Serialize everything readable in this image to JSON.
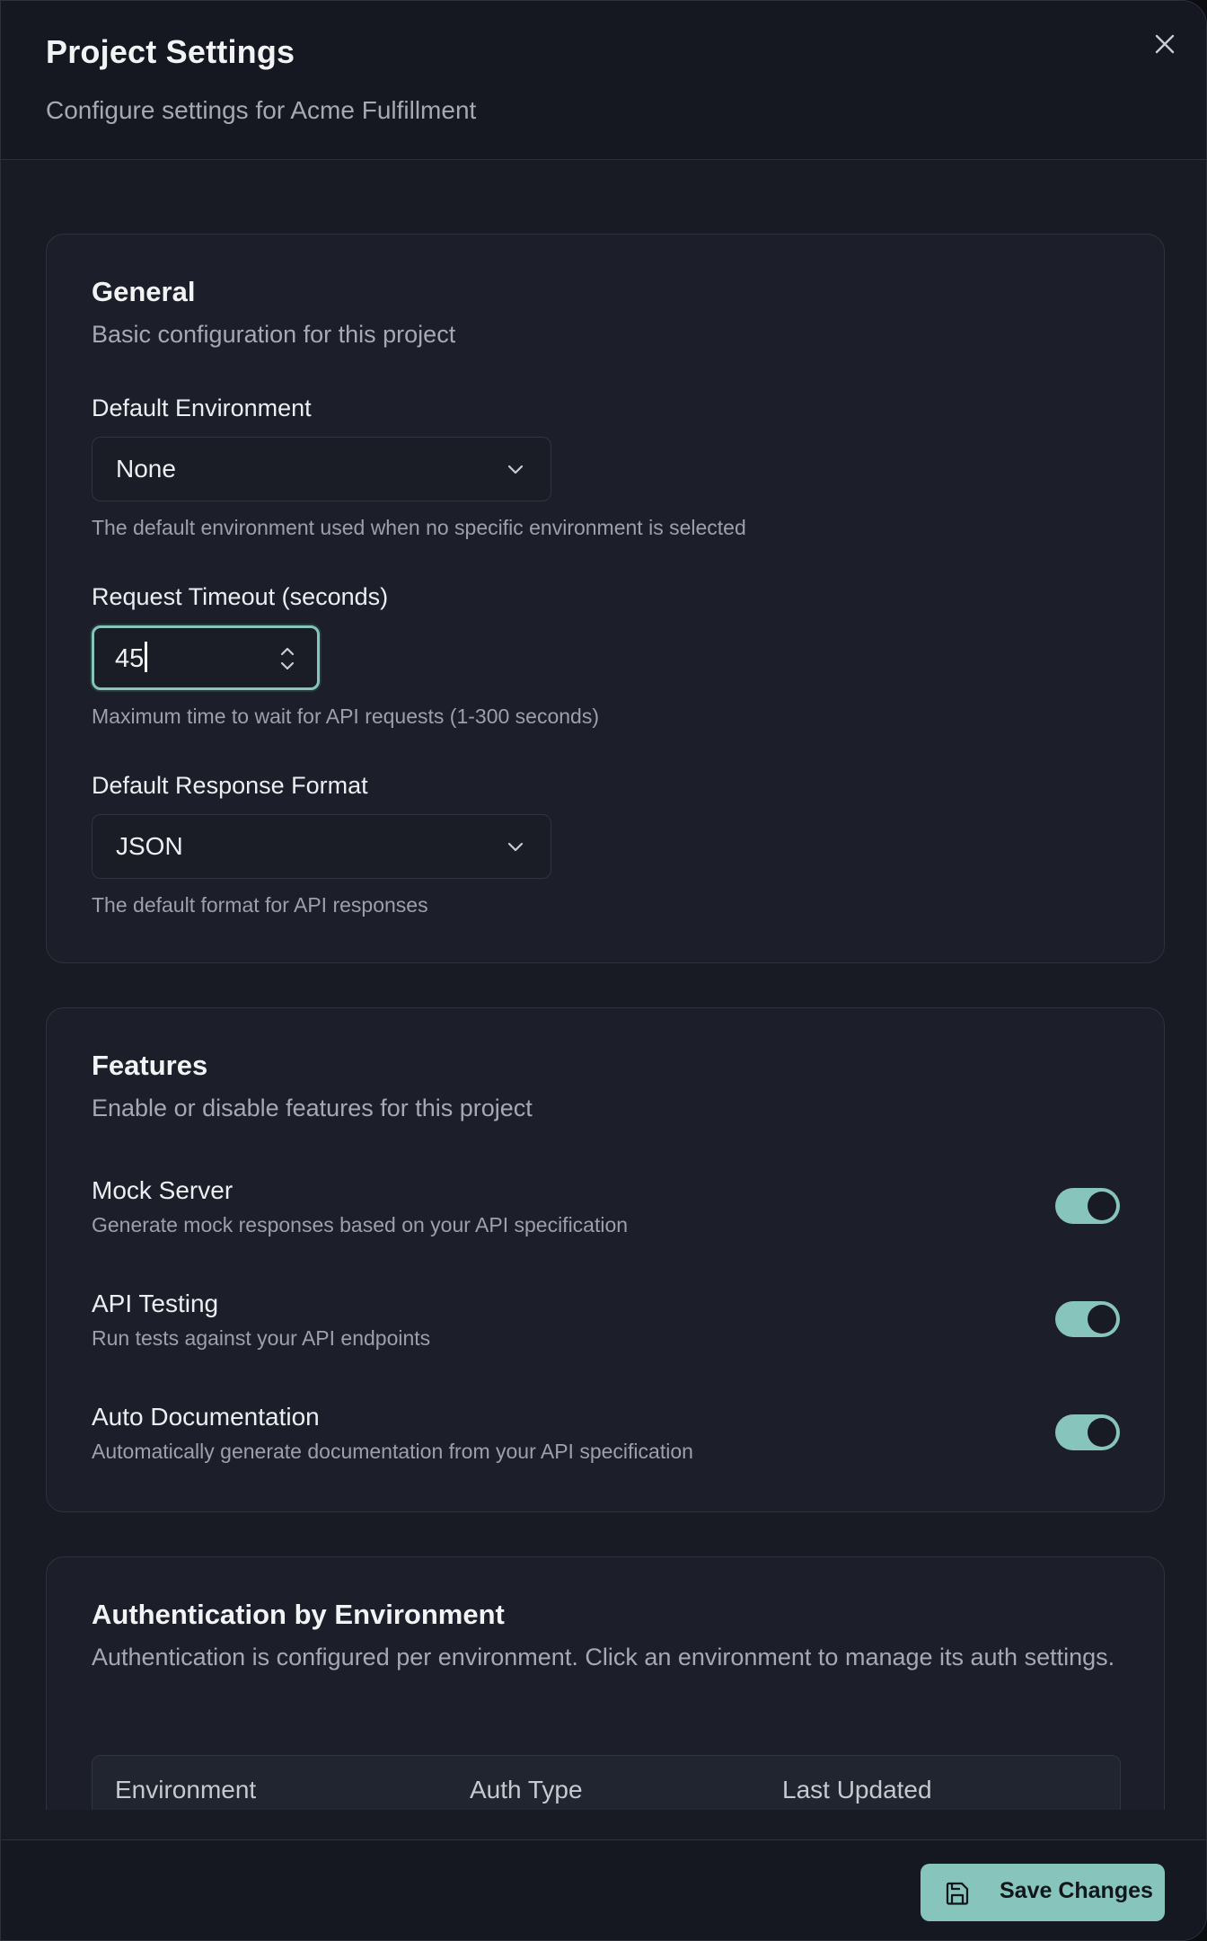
{
  "dialog": {
    "title": "Project Settings",
    "subtitle": "Configure settings for Acme Fulfillment"
  },
  "general": {
    "title": "General",
    "description": "Basic configuration for this project",
    "default_environment": {
      "label": "Default Environment",
      "value": "None",
      "help": "The default environment used when no specific environment is selected"
    },
    "request_timeout": {
      "label": "Request Timeout (seconds)",
      "value": "45",
      "help": "Maximum time to wait for API requests (1-300 seconds)"
    },
    "default_response_format": {
      "label": "Default Response Format",
      "value": "JSON",
      "help": "The default format for API responses"
    }
  },
  "features": {
    "title": "Features",
    "description": "Enable or disable features for this project",
    "items": [
      {
        "title": "Mock Server",
        "description": "Generate mock responses based on your API specification",
        "enabled": true
      },
      {
        "title": "API Testing",
        "description": "Run tests against your API endpoints",
        "enabled": true
      },
      {
        "title": "Auto Documentation",
        "description": "Automatically generate documentation from your API specification",
        "enabled": true
      }
    ]
  },
  "auth": {
    "title": "Authentication by Environment",
    "description": "Authentication is configured per environment. Click an environment to manage its auth settings.",
    "columns": [
      "Environment",
      "Auth Type",
      "Last Updated"
    ]
  },
  "footer": {
    "save_label": "Save Changes"
  },
  "colors": {
    "accent": "#86c4bc",
    "background": "#181b24",
    "card": "#1c1f29",
    "text": "#f2f3f5",
    "muted": "#a5a9b3"
  },
  "icons": {
    "close": "close-icon",
    "chevron": "chevron-down-icon",
    "stepper": "stepper-icon",
    "save": "save-icon"
  }
}
